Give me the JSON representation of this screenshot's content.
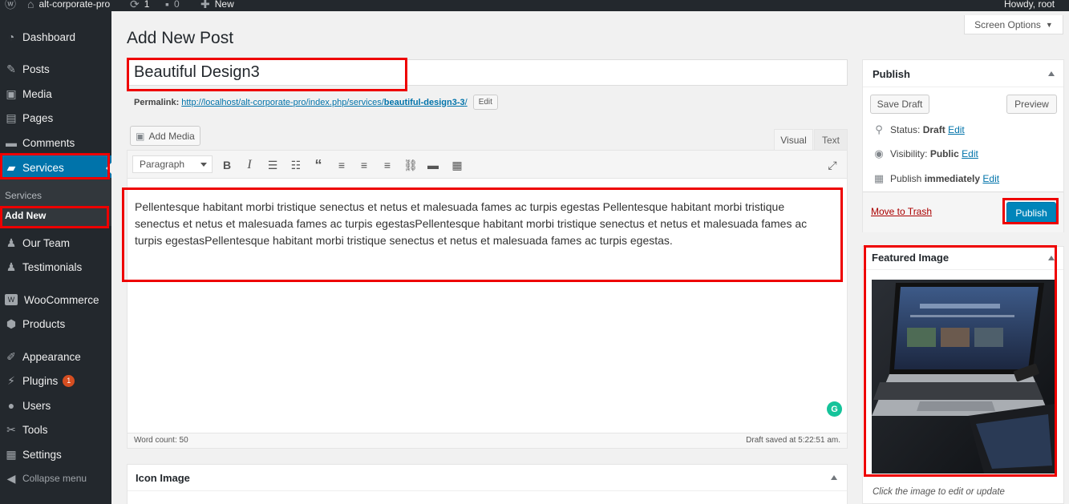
{
  "adminbar": {
    "site_name": "alt-corporate-pro",
    "updates_count": "1",
    "comments_count": "0",
    "new_label": "New",
    "howdy": "Howdy, root"
  },
  "sidebar": {
    "items": [
      {
        "label": "Dashboard",
        "icon": "dashboard-icon"
      },
      {
        "label": "Posts",
        "icon": "pin-icon"
      },
      {
        "label": "Media",
        "icon": "media-icon"
      },
      {
        "label": "Pages",
        "icon": "pages-icon"
      },
      {
        "label": "Comments",
        "icon": "comments-icon"
      },
      {
        "label": "Services",
        "icon": "folder-icon"
      },
      {
        "label": "Our Team",
        "icon": "users-icon"
      },
      {
        "label": "Testimonials",
        "icon": "users-icon"
      },
      {
        "label": "WooCommerce",
        "icon": "woo-icon"
      },
      {
        "label": "Products",
        "icon": "box-icon"
      },
      {
        "label": "Appearance",
        "icon": "brush-icon"
      },
      {
        "label": "Plugins",
        "icon": "plug-icon",
        "badge": "1"
      },
      {
        "label": "Users",
        "icon": "user-icon"
      },
      {
        "label": "Tools",
        "icon": "wrench-icon"
      },
      {
        "label": "Settings",
        "icon": "settings-icon"
      },
      {
        "label": "Collapse menu",
        "icon": "collapse-icon"
      }
    ],
    "submenu": [
      "Services",
      "Add New"
    ]
  },
  "page": {
    "title": "Add New Post",
    "screen_options": "Screen Options"
  },
  "post": {
    "title": "Beautiful Design3",
    "permalink_label": "Permalink:",
    "permalink_base": "http://localhost/alt-corporate-pro/index.php/services/",
    "permalink_slug": "beautiful-design3-3",
    "permalink_trail": "/",
    "edit_label": "Edit",
    "body": "Pellentesque habitant morbi tristique senectus et netus et malesuada fames ac turpis egestas Pellentesque habitant morbi tristique senectus et netus et malesuada fames ac turpis egestasPellentesque habitant morbi tristique senectus et netus et malesuada fames ac turpis egestasPellentesque habitant morbi tristique senectus et netus et malesuada fames ac turpis egestas."
  },
  "editor": {
    "add_media": "Add Media",
    "tab_visual": "Visual",
    "tab_text": "Text",
    "format": "Paragraph",
    "word_count": "Word count: 50",
    "draft_saved": "Draft saved at 5:22:51 am."
  },
  "publish": {
    "title": "Publish",
    "save_draft": "Save Draft",
    "preview": "Preview",
    "status_label": "Status:",
    "status_value": "Draft",
    "visibility_label": "Visibility:",
    "visibility_value": "Public",
    "publish_label": "Publish",
    "publish_value": "immediately",
    "edit": "Edit",
    "move_to_trash": "Move to Trash",
    "publish_button": "Publish"
  },
  "featured": {
    "title": "Featured Image",
    "caption": "Click the image to edit or update"
  },
  "icon_image": {
    "title": "Icon Image"
  },
  "colors": {
    "accent": "#0073aa",
    "highlight": "#e00000",
    "sidebar_bg": "#23282d"
  }
}
